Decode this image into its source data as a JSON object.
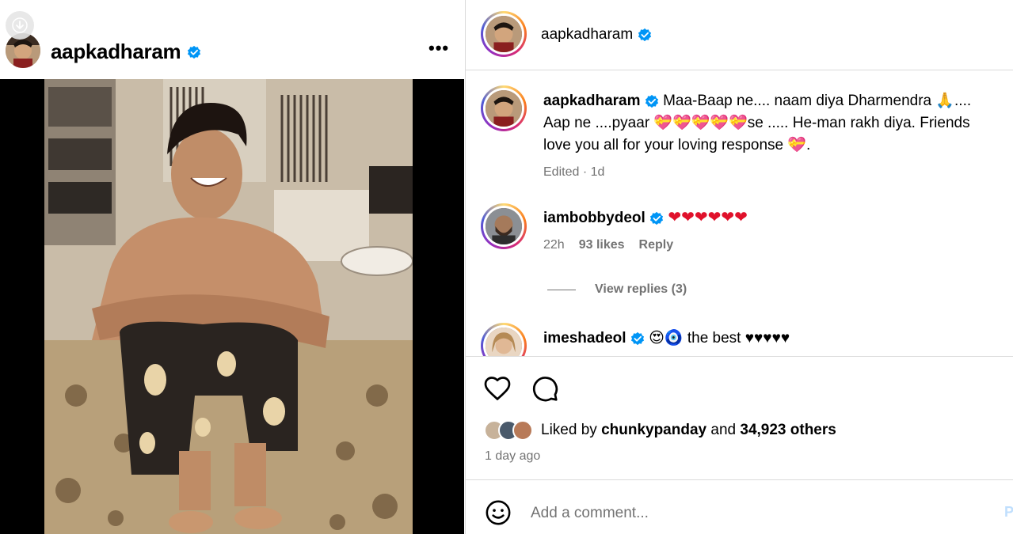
{
  "post": {
    "username": "aapkadharam",
    "more_label": "•••"
  },
  "sidebar_header": {
    "username": "aapkadharam"
  },
  "caption": {
    "username": "aapkadharam",
    "text_line1": "Maa-Baap ne.... naam diya Dharmendra 🙏....",
    "text_line2": "Aap ne ....pyaar 💝💝💝💝💝se ..... He-man rakh diya. Friends",
    "text_line3": "love you all for your loving response 💝.",
    "meta": "Edited · 1d"
  },
  "comments": [
    {
      "username": "iambobbydeol",
      "text": "❤❤❤❤❤❤",
      "time": "22h",
      "likes": "93 likes",
      "reply_label": "Reply",
      "view_replies": "View replies (3)"
    },
    {
      "username": "imeshadeol",
      "text": "😍🧿 the best ♥♥♥♥♥"
    }
  ],
  "likes": {
    "prefix": "Liked by",
    "user": "chunkypanday",
    "conj": "and",
    "others": "34,923 others"
  },
  "time_ago": "1 day ago",
  "add_comment": {
    "placeholder": "Add a comment...",
    "post_label": "Post"
  },
  "colors": {
    "verified": "#0095f6",
    "heart": "#e0112b",
    "meta_gray": "#737373",
    "border": "#dbdbdb"
  }
}
